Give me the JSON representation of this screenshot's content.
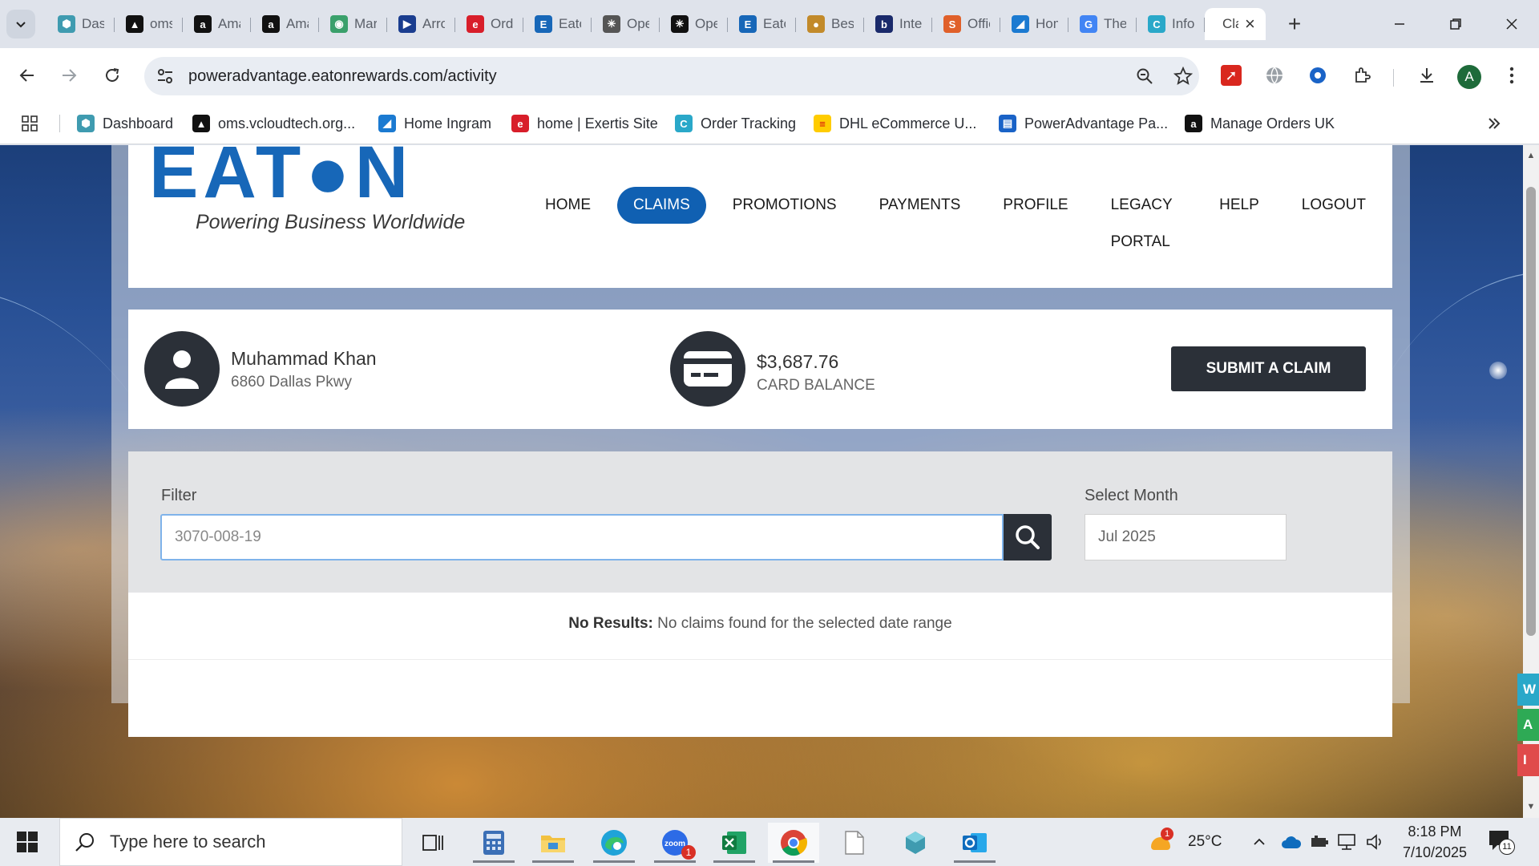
{
  "browser": {
    "tabs": [
      {
        "label": "Dashboard",
        "icon": "hexagon-icon",
        "color": "#3f9bb0",
        "glyph": "⬢"
      },
      {
        "label": "oms.vcloudtech",
        "icon": "triangle-logo-icon",
        "color": "#111111",
        "glyph": "▲"
      },
      {
        "label": "Amazon",
        "icon": "amazon-icon",
        "color": "#111111",
        "glyph": "a"
      },
      {
        "label": "Amazon",
        "icon": "amazon-icon",
        "color": "#111111",
        "glyph": "a"
      },
      {
        "label": "Marketplace",
        "icon": "circle-logo-icon",
        "color": "#3aa06b",
        "glyph": "◉"
      },
      {
        "label": "Arrow",
        "icon": "arrow-logo-icon",
        "color": "#1a3d8f",
        "glyph": "▶"
      },
      {
        "label": "Order",
        "icon": "exertis-icon",
        "color": "#d81e2a",
        "glyph": "e"
      },
      {
        "label": "Eaton",
        "icon": "e-logo-icon",
        "color": "#1767b8",
        "glyph": "E"
      },
      {
        "label": "OpenAI",
        "icon": "openai-icon",
        "color": "#555555",
        "glyph": "✳"
      },
      {
        "label": "OpenAI",
        "icon": "openai-icon",
        "color": "#111111",
        "glyph": "✳"
      },
      {
        "label": "Eaton",
        "icon": "e-logo-icon",
        "color": "#1767b8",
        "glyph": "E"
      },
      {
        "label": "Best",
        "icon": "bulb-icon",
        "color": "#c28a2a",
        "glyph": "●"
      },
      {
        "label": "Intel",
        "icon": "bu-logo-icon",
        "color": "#1a2a6b",
        "glyph": "b"
      },
      {
        "label": "Office",
        "icon": "stack-logo-icon",
        "color": "#e0602a",
        "glyph": "S"
      },
      {
        "label": "Home",
        "icon": "ingram-icon",
        "color": "#1b7ad1",
        "glyph": "◢"
      },
      {
        "label": "The",
        "icon": "google-icon",
        "color": "#4285f4",
        "glyph": "G"
      },
      {
        "label": "Info",
        "icon": "c-logo-icon",
        "color": "#2aa8c9",
        "glyph": "C"
      },
      {
        "label": "Claims",
        "icon": "",
        "color": "",
        "glyph": "",
        "active": true
      }
    ],
    "url": "poweradvantage.eatonrewards.com/activity",
    "avatar_letter": "A",
    "bookmarks": [
      {
        "label": "Dashboard",
        "icon": "hexagon-icon",
        "color": "#3f9bb0",
        "glyph": "⬢"
      },
      {
        "label": "oms.vcloudtech.org...",
        "icon": "triangle-logo-icon",
        "color": "#111111",
        "glyph": "▲"
      },
      {
        "label": "Home Ingram",
        "icon": "ingram-icon",
        "color": "#1b7ad1",
        "glyph": "◢"
      },
      {
        "label": "home | Exertis Site",
        "icon": "exertis-icon",
        "color": "#d81e2a",
        "glyph": "e"
      },
      {
        "label": "Order Tracking",
        "icon": "c-logo-icon",
        "color": "#2aa8c9",
        "glyph": "C"
      },
      {
        "label": "DHL eCommerce U...",
        "icon": "dhl-icon",
        "color": "#ffcc00",
        "glyph": "≡"
      },
      {
        "label": "PowerAdvantage Pa...",
        "icon": "document-icon",
        "color": "#1a63c7",
        "glyph": "▤"
      },
      {
        "label": "Manage Orders UK",
        "icon": "amazon-icon",
        "color": "#111111",
        "glyph": "a"
      }
    ]
  },
  "site": {
    "logo": "EAT●N",
    "tagline": "Powering Business Worldwide",
    "nav": [
      "HOME",
      "CLAIMS",
      "PROMOTIONS",
      "PAYMENTS",
      "PROFILE",
      "LEGACY PORTAL",
      "HELP",
      "LOGOUT"
    ],
    "active_nav": "CLAIMS"
  },
  "account": {
    "name": "Muhammad Khan",
    "address": "6860 Dallas Pkwy",
    "balance": "$3,687.76",
    "balance_label": "CARD BALANCE",
    "submit_label": "SUBMIT A CLAIM"
  },
  "filter": {
    "label": "Filter",
    "value": "3070-008-19",
    "month_label": "Select Month",
    "month_value": "Jul 2025"
  },
  "results": {
    "title": "No Results:",
    "message": "No claims found for the selected date range"
  },
  "taskbar": {
    "search_placeholder": "Type here to search",
    "weather": "25°C",
    "weather_badge": "1",
    "time": "8:18 PM",
    "date": "7/10/2025",
    "notif_count": "11",
    "zoom_badge": "1"
  },
  "colors": {
    "eaton_blue": "#1767b8",
    "nav_active": "#1060b2",
    "dark_button": "#2b3038"
  }
}
